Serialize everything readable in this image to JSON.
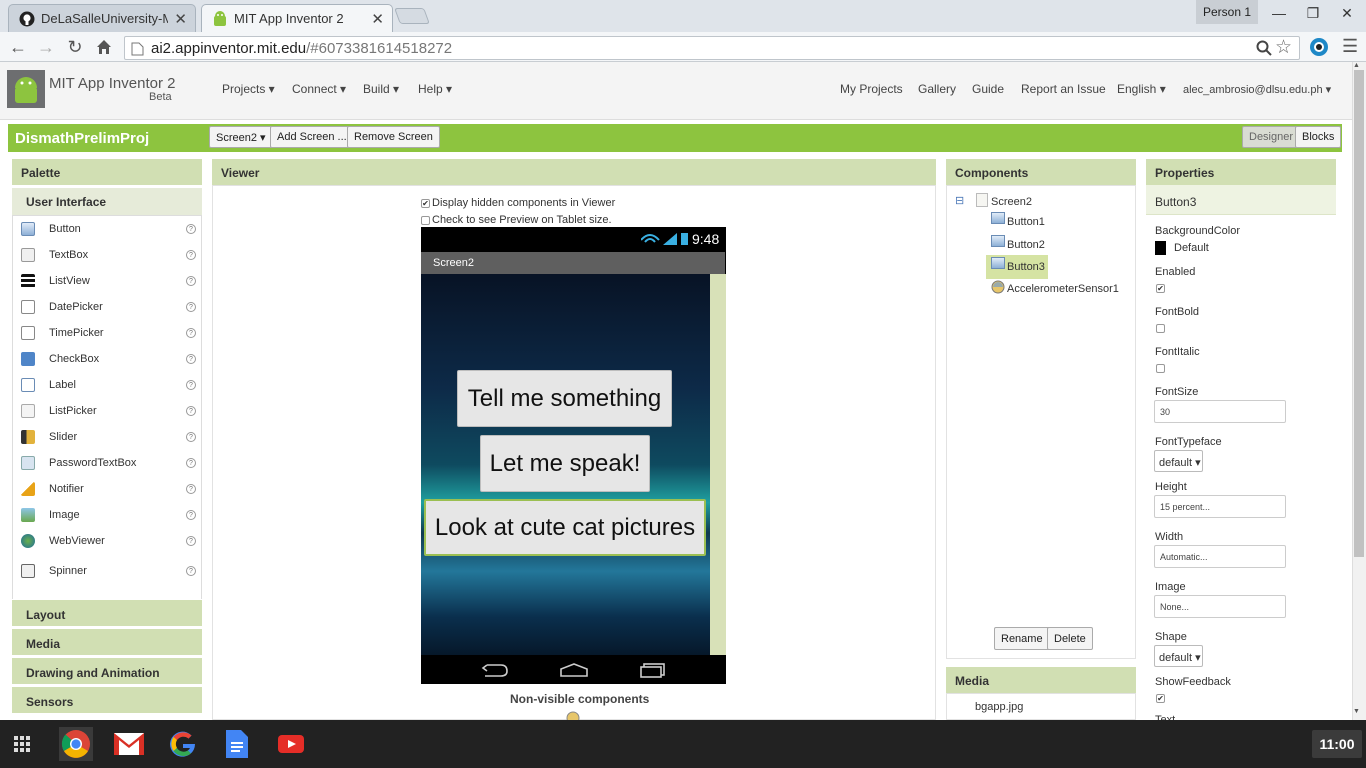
{
  "browser": {
    "tabs": [
      {
        "title": "DeLaSalleUniversity-Manil",
        "close": "✕"
      },
      {
        "title": "MIT App Inventor 2",
        "close": "✕"
      }
    ],
    "profile": "Person 1",
    "window_controls": [
      "—",
      "❐",
      "✕"
    ],
    "url_domain": "ai2.appinventor.mit.edu",
    "url_path": "/#6073381614518272"
  },
  "app": {
    "name": "MIT App Inventor 2",
    "subtitle": "Beta",
    "menus": [
      "Projects ▾",
      "Connect ▾",
      "Build ▾",
      "Help ▾"
    ],
    "links": [
      "My Projects",
      "Gallery",
      "Guide",
      "Report an Issue",
      "English ▾",
      "alec_ambrosio@dlsu.edu.ph ▾"
    ]
  },
  "project": {
    "name": "DismathPrelimProj",
    "screen_select": "Screen2 ▾",
    "add_screen": "Add Screen ...",
    "remove_screen": "Remove Screen",
    "designer": "Designer",
    "blocks": "Blocks"
  },
  "palette": {
    "title": "Palette",
    "category": "User Interface",
    "items": [
      "Button",
      "TextBox",
      "ListView",
      "DatePicker",
      "TimePicker",
      "CheckBox",
      "Label",
      "ListPicker",
      "Slider",
      "PasswordTextBox",
      "Notifier",
      "Image",
      "WebViewer",
      "Spinner"
    ],
    "help": "?",
    "drawers": [
      "Layout",
      "Media",
      "Drawing and Animation",
      "Sensors"
    ]
  },
  "viewer": {
    "title": "Viewer",
    "opt_hidden": "Display hidden components in Viewer",
    "opt_tablet": "Check to see Preview on Tablet size.",
    "phone": {
      "time": "9:48",
      "screen_title": "Screen2",
      "buttons": [
        "Tell me something",
        "Let me speak!",
        "Look at cute cat pictures"
      ]
    },
    "nonvisible": "Non-visible components"
  },
  "components": {
    "title": "Components",
    "tree": [
      "Screen2",
      "Button1",
      "Button2",
      "Button3",
      "AccelerometerSensor1"
    ],
    "rename": "Rename",
    "delete": "Delete",
    "collapse": "⊟"
  },
  "media": {
    "title": "Media",
    "files": [
      "bgapp.jpg"
    ]
  },
  "properties": {
    "title": "Properties",
    "selected": "Button3",
    "bgcolor_label": "BackgroundColor",
    "bgcolor_value": "Default",
    "enabled_label": "Enabled",
    "fontbold_label": "FontBold",
    "fontitalic_label": "FontItalic",
    "fontsize_label": "FontSize",
    "fontsize_value": "30",
    "fonttypeface_label": "FontTypeface",
    "fonttypeface_value": "default ▾",
    "height_label": "Height",
    "height_value": "15 percent...",
    "width_label": "Width",
    "width_value": "Automatic...",
    "image_label": "Image",
    "image_value": "None...",
    "shape_label": "Shape",
    "shape_value": "default ▾",
    "showfeedback_label": "ShowFeedback",
    "text_label": "Text"
  },
  "taskbar": {
    "clock": "11:00"
  },
  "colors": {
    "green": "#8dc43f",
    "panel": "#d1dfb3"
  }
}
